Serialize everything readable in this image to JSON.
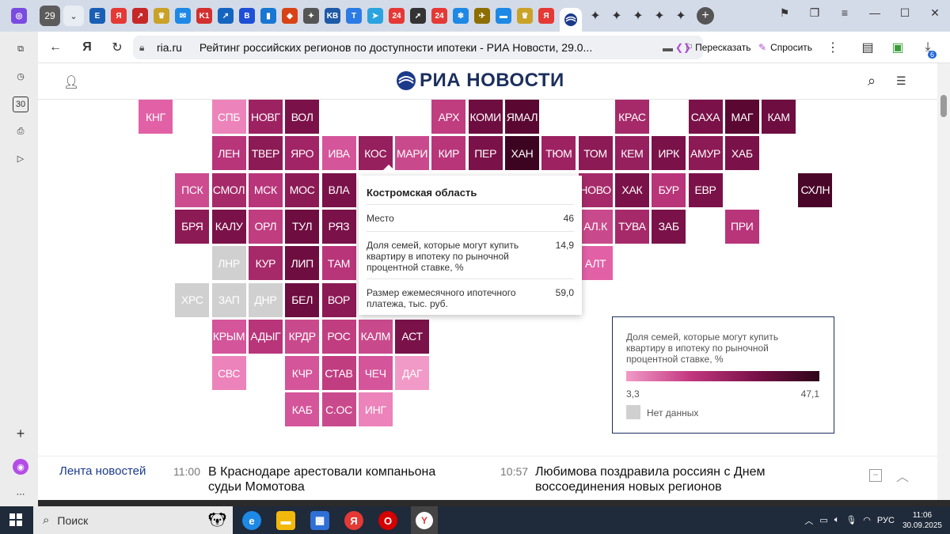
{
  "browser": {
    "tab_count": "29",
    "tab_icons": [
      {
        "name": "e-tab",
        "label": "E",
        "color": "#1a5fb4"
      },
      {
        "name": "yandex-tab",
        "label": "Я",
        "color": "#e53935"
      },
      {
        "name": "chart-tab",
        "label": "↗",
        "color": "#c62828"
      },
      {
        "name": "emblem-tab",
        "label": "♛",
        "color": "#c9a227"
      },
      {
        "name": "mail-tab",
        "label": "✉",
        "color": "#1e88e5"
      },
      {
        "name": "k1-tab",
        "label": "K1",
        "color": "#d32f2f"
      },
      {
        "name": "chart2-tab",
        "label": "↗",
        "color": "#1565c0"
      },
      {
        "name": "v-tab",
        "label": "B",
        "color": "#1e4fd6"
      },
      {
        "name": "doc-tab",
        "label": "▮",
        "color": "#1976d2"
      },
      {
        "name": "red-tab",
        "label": "◆",
        "color": "#d84315"
      },
      {
        "name": "star-tab",
        "label": "✦",
        "color": "#555555"
      },
      {
        "name": "kv-tab",
        "label": "KB",
        "color": "#1e5aa8"
      },
      {
        "name": "t-tab",
        "label": "T",
        "color": "#2c7be5"
      },
      {
        "name": "telegram-tab",
        "label": "➤",
        "color": "#2aa3df"
      },
      {
        "name": "24-tab",
        "label": "24",
        "color": "#e53935"
      },
      {
        "name": "arrow-tab",
        "label": "➚",
        "color": "#333333"
      },
      {
        "name": "24b-tab",
        "label": "24",
        "color": "#e53935"
      },
      {
        "name": "snow-tab",
        "label": "❄",
        "color": "#1e88e5"
      },
      {
        "name": "eagle-tab",
        "label": "✈",
        "color": "#8d6e00"
      },
      {
        "name": "chat-tab",
        "label": "▬",
        "color": "#1e88e5"
      },
      {
        "name": "emblem2-tab",
        "label": "♛",
        "color": "#c9a227"
      },
      {
        "name": "yandex2-tab",
        "label": "Я",
        "color": "#e53935"
      }
    ],
    "url_host": "ria.ru",
    "page_title": "Рейтинг российских регионов по доступности ипотеки - РИА Новости, 29.0...",
    "retell_label": "Пересказать",
    "ask_label": "Спросить",
    "downloads_count": "6",
    "rail_30": "30"
  },
  "site": {
    "logo": "РИА НОВОСТИ"
  },
  "chart_data": {
    "type": "heatmap",
    "description_source": "Tile map of Russian regions colored by value",
    "legend_title": "Доля семей, которые могут купить квартиру в ипотеку по рыночной процентной ставке, %",
    "scale_min": "3,3",
    "scale_max": "47,1",
    "no_data_label": "Нет данных",
    "colors": {
      "low": "#f29ac7",
      "mid": "#c2377f",
      "high": "#7a1249",
      "max": "#2e0418",
      "no_data": "#d0d0d0"
    },
    "tiles": [
      {
        "label": "КНГ",
        "color": "#e261a6",
        "col": 0,
        "row": 0
      },
      {
        "label": "СПБ",
        "color": "#ec83ba",
        "col": 2,
        "row": 0
      },
      {
        "label": "НОВГ",
        "color": "#9d2262",
        "col": 3,
        "row": 0
      },
      {
        "label": "ВОЛ",
        "color": "#7a1249",
        "col": 4,
        "row": 0
      },
      {
        "label": "АРХ",
        "color": "#c03d80",
        "col": 8,
        "row": 0
      },
      {
        "label": "КОМИ",
        "color": "#6e0d40",
        "col": 9,
        "row": 0
      },
      {
        "label": "ЯМАЛ",
        "color": "#5a0832",
        "col": 10,
        "row": 0
      },
      {
        "label": "КРАС",
        "color": "#a62a69",
        "col": 13,
        "row": 0
      },
      {
        "label": "САХА",
        "color": "#7a1249",
        "col": 15,
        "row": 0
      },
      {
        "label": "МАГ",
        "color": "#5a0832",
        "col": 16,
        "row": 0
      },
      {
        "label": "КАМ",
        "color": "#6e0d40",
        "col": 17,
        "row": 0
      },
      {
        "label": "ЛЕН",
        "color": "#b8357a",
        "col": 2,
        "row": 1
      },
      {
        "label": "ТВЕР",
        "color": "#8c1a55",
        "col": 3,
        "row": 1
      },
      {
        "label": "ЯРО",
        "color": "#a02466",
        "col": 4,
        "row": 1
      },
      {
        "label": "ИВА",
        "color": "#d4559a",
        "col": 5,
        "row": 1
      },
      {
        "label": "КОС",
        "color": "#961f5e",
        "col": 6,
        "row": 1
      },
      {
        "label": "МАРИ",
        "color": "#c94a8c",
        "col": 7,
        "row": 1
      },
      {
        "label": "КИР",
        "color": "#b8357a",
        "col": 8,
        "row": 1
      },
      {
        "label": "ПЕР",
        "color": "#7a1249",
        "col": 9,
        "row": 1
      },
      {
        "label": "ХАН",
        "color": "#3d0422",
        "col": 10,
        "row": 1
      },
      {
        "label": "ТЮМ",
        "color": "#9d2262",
        "col": 11,
        "row": 1
      },
      {
        "label": "ТОМ",
        "color": "#8c1a55",
        "col": 12,
        "row": 1
      },
      {
        "label": "КЕМ",
        "color": "#961f5e",
        "col": 13,
        "row": 1
      },
      {
        "label": "ИРК",
        "color": "#7a1249",
        "col": 14,
        "row": 1
      },
      {
        "label": "АМУР",
        "color": "#8c1a55",
        "col": 15,
        "row": 1
      },
      {
        "label": "ХАБ",
        "color": "#7a1249",
        "col": 16,
        "row": 1
      },
      {
        "label": "ПСК",
        "color": "#cc4c8f",
        "col": 1,
        "row": 2
      },
      {
        "label": "СМОЛ",
        "color": "#a62a69",
        "col": 2,
        "row": 2
      },
      {
        "label": "МСК",
        "color": "#b8357a",
        "col": 3,
        "row": 2
      },
      {
        "label": "МОС",
        "color": "#8c1a55",
        "col": 4,
        "row": 2
      },
      {
        "label": "ВЛА",
        "color": "#7a1249",
        "col": 5,
        "row": 2
      },
      {
        "label": "НОВО",
        "color": "#a62a69",
        "col": 12,
        "row": 2
      },
      {
        "label": "ХАК",
        "color": "#7a1249",
        "col": 13,
        "row": 2
      },
      {
        "label": "БУР",
        "color": "#b8357a",
        "col": 14,
        "row": 2
      },
      {
        "label": "ЕВР",
        "color": "#7a1249",
        "col": 15,
        "row": 2
      },
      {
        "label": "СХЛН",
        "color": "#4a0629",
        "col": 18,
        "row": 2
      },
      {
        "label": "БРЯ",
        "color": "#8c1a55",
        "col": 1,
        "row": 3
      },
      {
        "label": "КАЛУ",
        "color": "#7a1249",
        "col": 2,
        "row": 3
      },
      {
        "label": "ОРЛ",
        "color": "#c03d80",
        "col": 3,
        "row": 3
      },
      {
        "label": "ТУЛ",
        "color": "#6e0d40",
        "col": 4,
        "row": 3
      },
      {
        "label": "РЯЗ",
        "color": "#7a1249",
        "col": 5,
        "row": 3
      },
      {
        "label": "АЛ.К",
        "color": "#c94a8c",
        "col": 12,
        "row": 3
      },
      {
        "label": "ТУВА",
        "color": "#a62a69",
        "col": 13,
        "row": 3
      },
      {
        "label": "ЗАБ",
        "color": "#7a1249",
        "col": 14,
        "row": 3
      },
      {
        "label": "ПРИ",
        "color": "#b8357a",
        "col": 16,
        "row": 3
      },
      {
        "label": "ЛНР",
        "color": "#d0d0d0",
        "col": 2,
        "row": 4
      },
      {
        "label": "КУР",
        "color": "#a62a69",
        "col": 3,
        "row": 4
      },
      {
        "label": "ЛИП",
        "color": "#6e0d40",
        "col": 4,
        "row": 4
      },
      {
        "label": "ТАМ",
        "color": "#b8357a",
        "col": 5,
        "row": 4
      },
      {
        "label": "АЛТ",
        "color": "#e261a6",
        "col": 12,
        "row": 4
      },
      {
        "label": "ХРС",
        "color": "#d0d0d0",
        "col": 1,
        "row": 5
      },
      {
        "label": "ЗАП",
        "color": "#d0d0d0",
        "col": 2,
        "row": 5
      },
      {
        "label": "ДНР",
        "color": "#d0d0d0",
        "col": 3,
        "row": 5
      },
      {
        "label": "БЕЛ",
        "color": "#6e0d40",
        "col": 4,
        "row": 5
      },
      {
        "label": "ВОР",
        "color": "#8c1a55",
        "col": 5,
        "row": 5
      },
      {
        "label": "КРЫМ",
        "color": "#d4559a",
        "col": 2,
        "row": 6
      },
      {
        "label": "АДЫГ",
        "color": "#b8357a",
        "col": 3,
        "row": 6
      },
      {
        "label": "КРДР",
        "color": "#c94a8c",
        "col": 4,
        "row": 6
      },
      {
        "label": "РОС",
        "color": "#c03d80",
        "col": 5,
        "row": 6
      },
      {
        "label": "КАЛМ",
        "color": "#c94a8c",
        "col": 6,
        "row": 6
      },
      {
        "label": "АСТ",
        "color": "#7a1249",
        "col": 7,
        "row": 6
      },
      {
        "label": "СВС",
        "color": "#ec83ba",
        "col": 2,
        "row": 7
      },
      {
        "label": "КЧР",
        "color": "#d4559a",
        "col": 4,
        "row": 7
      },
      {
        "label": "СТАВ",
        "color": "#c03d80",
        "col": 5,
        "row": 7
      },
      {
        "label": "ЧЕЧ",
        "color": "#d4559a",
        "col": 6,
        "row": 7
      },
      {
        "label": "ДАГ",
        "color": "#f29ac7",
        "col": 7,
        "row": 7
      },
      {
        "label": "КАБ",
        "color": "#d4559a",
        "col": 4,
        "row": 8
      },
      {
        "label": "С.ОС",
        "color": "#c94a8c",
        "col": 5,
        "row": 8
      },
      {
        "label": "ИНГ",
        "color": "#ec83ba",
        "col": 6,
        "row": 8
      }
    ]
  },
  "tooltip": {
    "title": "Костромская область",
    "rows": [
      {
        "label": "Место",
        "value": "46"
      },
      {
        "label": "Доля семей, которые могут купить квартиру в ипотеку по рыночной процентной ставке, %",
        "value": "14,9"
      },
      {
        "label": "Размер ежемесячного ипотечного платежа, тыс. руб.",
        "value": "59,0"
      }
    ]
  },
  "feed": {
    "label": "Лента новостей",
    "items": [
      {
        "time": "11:00",
        "text": "В Краснодаре арестовали компаньона судьи Момотова"
      },
      {
        "time": "10:57",
        "text": "Любимова поздравила россиян с Днем воссоединения новых регионов"
      }
    ]
  },
  "taskbar": {
    "search_placeholder": "Поиск",
    "lang": "РУС",
    "time": "11:06",
    "date": "30.09.2025"
  }
}
